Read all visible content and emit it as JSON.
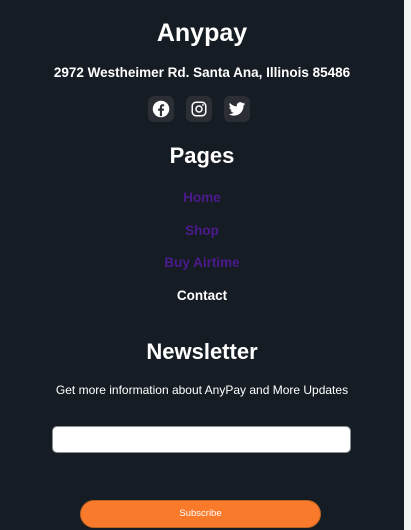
{
  "footer": {
    "brand": "Anypay",
    "address": "2972 Westheimer Rd. Santa Ana, Illinois 85486",
    "social": [
      {
        "name": "facebook",
        "icon": "facebook-icon"
      },
      {
        "name": "instagram",
        "icon": "instagram-icon"
      },
      {
        "name": "twitter",
        "icon": "twitter-icon"
      }
    ],
    "pages_heading": "Pages",
    "pages": [
      {
        "label": "Home",
        "active": false
      },
      {
        "label": "Shop",
        "active": false
      },
      {
        "label": "Buy Airtime",
        "active": false
      },
      {
        "label": "Contact",
        "active": true
      }
    ],
    "newsletter": {
      "heading": "Newsletter",
      "text": "Get more information about AnyPay and More Updates",
      "email_value": "",
      "email_placeholder": "",
      "subscribe_label": "Subscribe"
    }
  },
  "colors": {
    "background": "#161c23",
    "link": "#4b1a8c",
    "accent": "#f97a2b"
  }
}
